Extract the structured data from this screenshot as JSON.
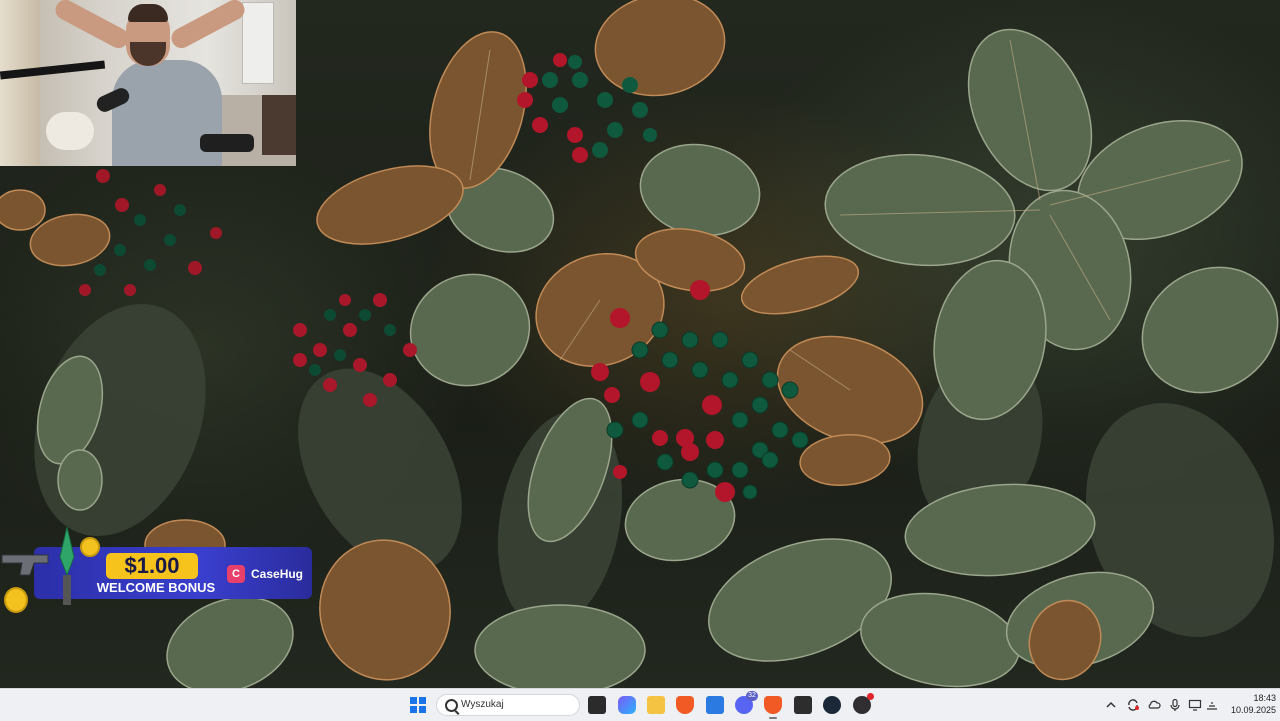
{
  "desktop": {
    "wallpaper": "leaves-and-berries",
    "colors": {
      "leaf_green": "#4c5a48",
      "leaf_brown": "#8a5a2a",
      "berry_red": "#b3162a",
      "berry_green": "#0f5a3f"
    }
  },
  "webcam_overlay": {
    "subject": "streamer-with-hands-on-head",
    "icon": "webcam-feed"
  },
  "bonus_banner": {
    "amount": "$1.00",
    "text": "WELCOME BONUS",
    "brand": "CaseHug",
    "colors": {
      "panel": "#3a3fce",
      "amount_bg": "#f6c21c"
    }
  },
  "taskbar": {
    "search_placeholder": "Wyszukaj",
    "pinned": [
      {
        "name": "task-view",
        "icon": "task-view-icon",
        "color": "#2b2b2b"
      },
      {
        "name": "copilot",
        "icon": "copilot-icon",
        "color": "#7a5af5"
      },
      {
        "name": "file-explorer",
        "icon": "folder-icon",
        "color": "#f5c342"
      },
      {
        "name": "brave",
        "icon": "brave-icon",
        "color": "#f15a24"
      },
      {
        "name": "microsoft-store",
        "icon": "store-icon",
        "color": "#2a7ae2"
      },
      {
        "name": "discord",
        "icon": "discord-icon",
        "color": "#5865f2",
        "badge": "32"
      },
      {
        "name": "brave-active",
        "icon": "brave-icon",
        "color": "#f15a24",
        "active": true
      },
      {
        "name": "terminal",
        "icon": "terminal-icon",
        "color": "#2d2d2d"
      },
      {
        "name": "steam",
        "icon": "steam-icon",
        "color": "#1b2838"
      },
      {
        "name": "obs",
        "icon": "obs-icon",
        "color": "#302e31",
        "notify": true
      }
    ],
    "tray": [
      "chevron-up-icon",
      "sync-icon",
      "cloud-icon",
      "microphone-icon",
      "display-icon",
      "network-icon",
      "volume-icon"
    ],
    "clock": {
      "time": "18:43",
      "date": "10.09.2025"
    }
  }
}
